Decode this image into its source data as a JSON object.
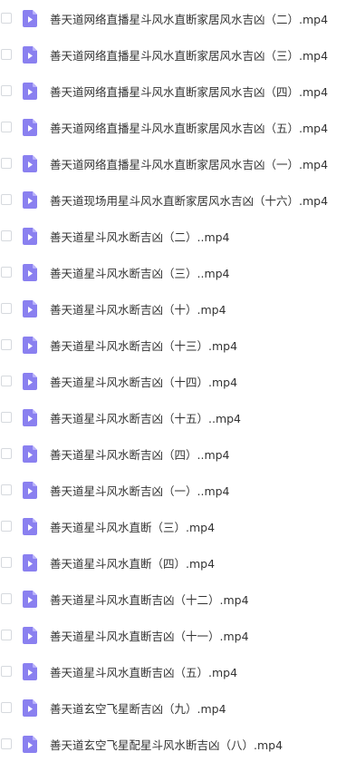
{
  "colors": {
    "icon_fill": "#8a80f0",
    "icon_fold": "#b9b2fa",
    "text": "#333333",
    "checkbox_border": "#d6d9de"
  },
  "icons": {
    "file": "video-file-icon",
    "checkbox": "checkbox"
  },
  "files": [
    {
      "name": "善天道网络直播星斗风水直断家居风水吉凶（二）.mp4"
    },
    {
      "name": "善天道网络直播星斗风水直断家居风水吉凶（三）.mp4"
    },
    {
      "name": "善天道网络直播星斗风水直断家居风水吉凶（四）.mp4"
    },
    {
      "name": "善天道网络直播星斗风水直断家居风水吉凶（五）.mp4"
    },
    {
      "name": "善天道网络直播星斗风水直断家居风水吉凶（一）.mp4"
    },
    {
      "name": "善天道现场用星斗风水直断家居风水吉凶（十六）.mp4"
    },
    {
      "name": "善天道星斗风水断吉凶（二）..mp4"
    },
    {
      "name": "善天道星斗风水断吉凶（三）..mp4"
    },
    {
      "name": "善天道星斗风水断吉凶（十）.mp4"
    },
    {
      "name": "善天道星斗风水断吉凶（十三）.mp4"
    },
    {
      "name": "善天道星斗风水断吉凶（十四）.mp4"
    },
    {
      "name": "善天道星斗风水断吉凶（十五）..mp4"
    },
    {
      "name": "善天道星斗风水断吉凶（四）..mp4"
    },
    {
      "name": "善天道星斗风水断吉凶（一）..mp4"
    },
    {
      "name": "善天道星斗风水直断（三）.mp4"
    },
    {
      "name": "善天道星斗风水直断（四）.mp4"
    },
    {
      "name": "善天道星斗风水直断吉凶（十二）.mp4"
    },
    {
      "name": "善天道星斗风水直断吉凶（十一）.mp4"
    },
    {
      "name": "善天道星斗风水直断吉凶（五）.mp4"
    },
    {
      "name": "善天道玄空飞星断吉凶（九）.mp4"
    },
    {
      "name": "善天道玄空飞星配星斗风水断吉凶（八）.mp4"
    }
  ]
}
